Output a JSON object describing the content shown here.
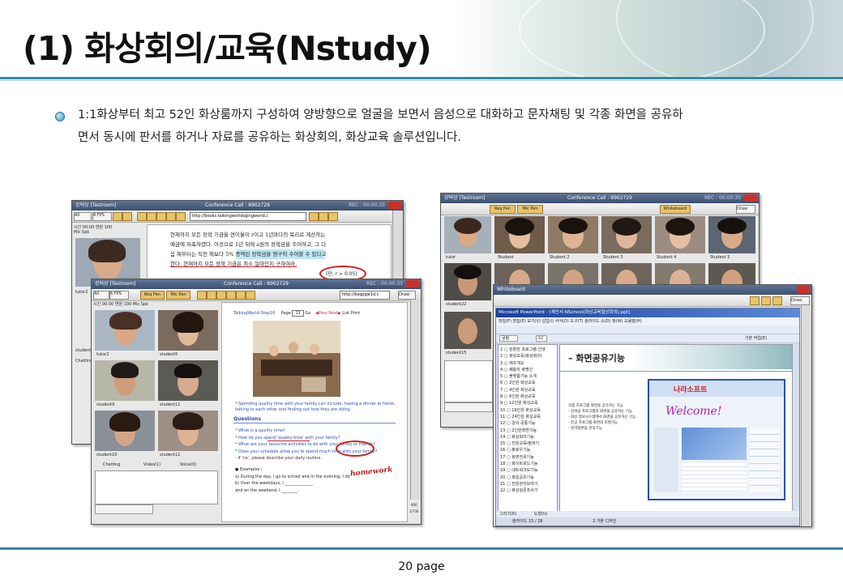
{
  "slide": {
    "title": "(1) 화상회의/교육(Nstudy)",
    "description_line1": "1:1화상부터 최고 52인 화상룸까지 구성하여 양방향으로 얼굴을 보면서 음성으로 대화하고 문자채팅 및 각종 화면을 공유하",
    "description_line2": "면서 동시에 판서를 하거나 자료를 공유하는 화상회의, 화상교육 솔루션입니다.",
    "page_number": "20 page"
  },
  "window_back_left": {
    "title": "강덕상 [Testroom]",
    "center_title": "Conference Call : 8902729",
    "rec": "REC : 00:00:33",
    "url": "http://books.talkingworldsgingworld.c",
    "toolbar_labels": [
      "All",
      "6 FPS",
      "시간",
      "00:00",
      "연원",
      "100",
      "Mic",
      "Spk"
    ],
    "doc_line1": "현재까지 모든 장학 기금을 연이율이 r이고 1년마다의 복리로 계산하는",
    "doc_line2": "예금에 저축하였다. 이것으로 1년 뒤에 a원의 장학금을 주어하고, 그 다",
    "doc_line3": "음 해부터는 직전 해보다 5% 증액된 장학금을 영구히 수여할 수 있다고",
    "doc_line4": "한다. 현재까지 모든 장학 기금은 최소 얼마인지 구하여라.",
    "doc_note": "(단, r > 0.05)",
    "side_labels": [
      "tutor2",
      "student"
    ],
    "tab": "Chatting"
  },
  "window_front_left": {
    "title": "강덕상 [Testroom]",
    "center_title": "Conference Call : 8902729",
    "rec": "REC : 00:00:33",
    "buttons": [
      "Req Pen",
      "Mic Pen"
    ],
    "url": "http://bsqpgw1d.c",
    "toolbar_labels": [
      "All",
      "6 FPS",
      "시간",
      "00:00",
      "연원",
      "100",
      "Mic",
      "Spk"
    ],
    "draw": "Draw",
    "video_labels": [
      "tutor2",
      "student5",
      "student9",
      "student11",
      "student10",
      "student11"
    ],
    "tabs": [
      "Chatting",
      "Video(1)",
      "Voice(0)"
    ],
    "lesson": {
      "header": "TalkingWorld-Step10",
      "page_label": "Page",
      "page_value": "11",
      "go": "Go",
      "prev_next": "◀Prev Next▶",
      "list": "List",
      "print": "Print",
      "caption": "* Spending quality time with your family can include, having a dinner at home, talking to each other and finding out how they are doing.",
      "questions_title": "Questions",
      "questions": [
        "* What is a quality time?",
        "* How do you spend 'quality time' with your family?",
        "* What are your favourite activities to do with your family or friends?",
        "* Does your schedule allow you to spend much time with your family?",
        "  - If 'no', please describe your daily routine."
      ],
      "examples_title": "● Examples :",
      "examples": [
        "a) During the day, I go to school and in the evening, I do",
        "b) Over the weekdays, I ______________",
        "    and on the weekend, I ________."
      ],
      "handwriting": "homework",
      "zoom": "900",
      "pos": "1/730"
    }
  },
  "window_back_right": {
    "title": "강덕상 [Testroom]",
    "center_title": "Conference Call : 8902729",
    "rec": "REC : 00:00:33",
    "buttons": [
      "Req Pen",
      "Mic Pen",
      "Whiteboard"
    ],
    "draw": "Draw",
    "video_labels": [
      "tutor",
      "Student",
      "Student 2",
      "Student 3",
      "Student 4",
      "Student 5",
      "student22",
      "student15"
    ]
  },
  "window_front_right": {
    "title": "Whiteboard",
    "draw": "Draw",
    "ppt_title": "Microsoft PowerPoint - [제안서-NSchool(화상교육협상회의).ppt]",
    "menu": [
      "파일(F)",
      "편집(E)",
      "보기(V)",
      "삽입(I)",
      "서식(O)",
      "도구(T)",
      "슬라이드 쇼(D)",
      "창(W)",
      "도움말(H)"
    ],
    "font_name": "굴림",
    "font_size": "12",
    "design_label": "기본 작업(E)",
    "outline_items": [
      "1 ▢ 원활한 프로그램 선생",
      "2 ▢ 화상교육(화상회의)",
      "3 ▢ 제조개요",
      "4 ▢ 폐충의 화명신",
      "5 ▢ 플랫폼기능 소개",
      "6 ▢ 2인원 화상교육",
      "7 ▢ 4인원 화상교육",
      "8 ▢ 6인원 화상교육",
      "9 ▢ 12인원 화상교육",
      "10 ▢ 16인원 화상교육",
      "11 ▢ 24인원 화상교육",
      "12 ▢ 강의 공통기능",
      "13 ▢ 2인원화면기능",
      "14 ▢ 화상회의기능",
      "15 ▢ 전원교육/참여기",
      "16 ▢ 플로우기능",
      "17 ▢ 화면전유기능",
      "18 ▢ 화이트보드기능",
      "19 ▢ 네트워크모기능",
      "20 ▢ 파일공유기능",
      "21 ▢ 전원관리모여기",
      "22 ▢ 화상설문조사기"
    ],
    "slide_title": "– 화면공유기능",
    "slide_bullets": [
      "각종 프로그램 화면을 공유하는 기능",
      "- 강의용 프로그램의 화면을 공유하는 기능",
      "- 화상 정보시스템에서 화면을 공유하는 기능",
      "- 전공 프로그램 화면의 조명기능",
      "- 원격화면을 관리기능"
    ],
    "web_logo": "나라소프트",
    "web_welcome": "Welcome!",
    "status_left": "슬라이드 15 / 28",
    "status_mid": "2.가본 디자인",
    "draw_label": "그리기(R)",
    "shapes_label": "도형(U)"
  },
  "colors": {
    "accent_rule": "#2f8aa8",
    "titlebar": "#3c4f73",
    "annotation_red": "#d02020",
    "link_blue": "#2a4fb4"
  }
}
